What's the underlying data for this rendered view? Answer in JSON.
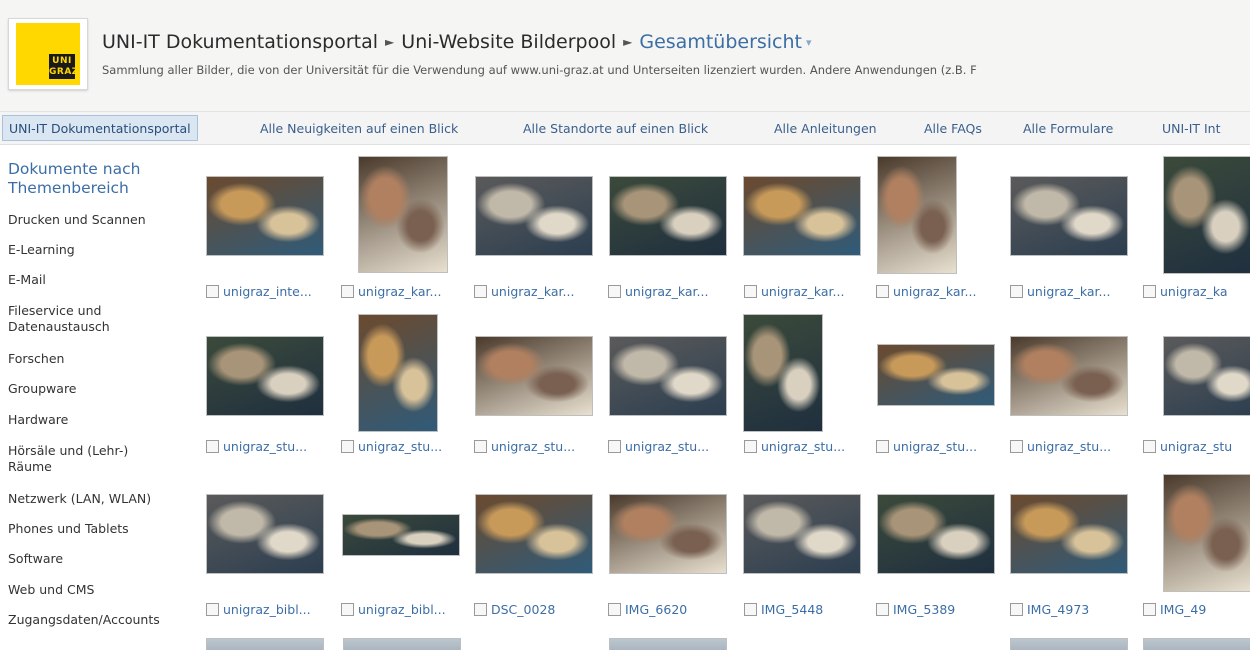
{
  "header": {
    "logo_text": "UNI GRAZ",
    "breadcrumb": [
      {
        "label": "UNI-IT Dokumentationsportal"
      },
      {
        "label": "Uni-Website Bilderpool"
      },
      {
        "label": "Gesamtübersicht"
      }
    ],
    "description": "Sammlung aller Bilder, die von der Universität für die Verwendung auf www.uni-graz.at und Unterseiten lizenziert wurden. Andere Anwendungen (z.B. F"
  },
  "topnav": [
    {
      "label": "UNI-IT Dokumentationsportal",
      "selected": true
    },
    {
      "label": "Alle Neuigkeiten auf einen Blick"
    },
    {
      "label": "Alle Standorte auf einen Blick"
    },
    {
      "label": "Alle Anleitungen"
    },
    {
      "label": "Alle FAQs"
    },
    {
      "label": "Alle Formulare"
    },
    {
      "label": "UNI-IT Int"
    }
  ],
  "leftnav": {
    "heading": "Dokumente nach Themenbereich",
    "items": [
      "Drucken und Scannen",
      "E-Learning",
      "E-Mail",
      "Fileservice und Datenaustausch",
      "Forschen",
      "Groupware",
      "Hardware",
      "Hörsäle und (Lehr-) Räume",
      "Netzwerk (LAN, WLAN)",
      "Phones und Tablets",
      "Software",
      "Web und CMS",
      "Zugangsdaten/Accounts"
    ]
  },
  "gallery": {
    "rows": [
      [
        "unigraz_inte...",
        "unigraz_kar...",
        "unigraz_kar...",
        "unigraz_kar...",
        "unigraz_kar...",
        "unigraz_kar...",
        "unigraz_kar...",
        "unigraz_ka"
      ],
      [
        "unigraz_stu...",
        "unigraz_stu...",
        "unigraz_stu...",
        "unigraz_stu...",
        "unigraz_stu...",
        "unigraz_stu...",
        "unigraz_stu...",
        "unigraz_stu"
      ],
      [
        "unigraz_bibl...",
        "unigraz_bibl...",
        "DSC_0028",
        "IMG_6620",
        "IMG_5448",
        "IMG_5389",
        "IMG_4973",
        "IMG_49"
      ]
    ]
  },
  "colors": {
    "link": "#3c6ea6",
    "header_bg": "#f5f5f3",
    "logo_yellow": "#ffd800",
    "nav_selected_bg": "#dbe6f3"
  }
}
